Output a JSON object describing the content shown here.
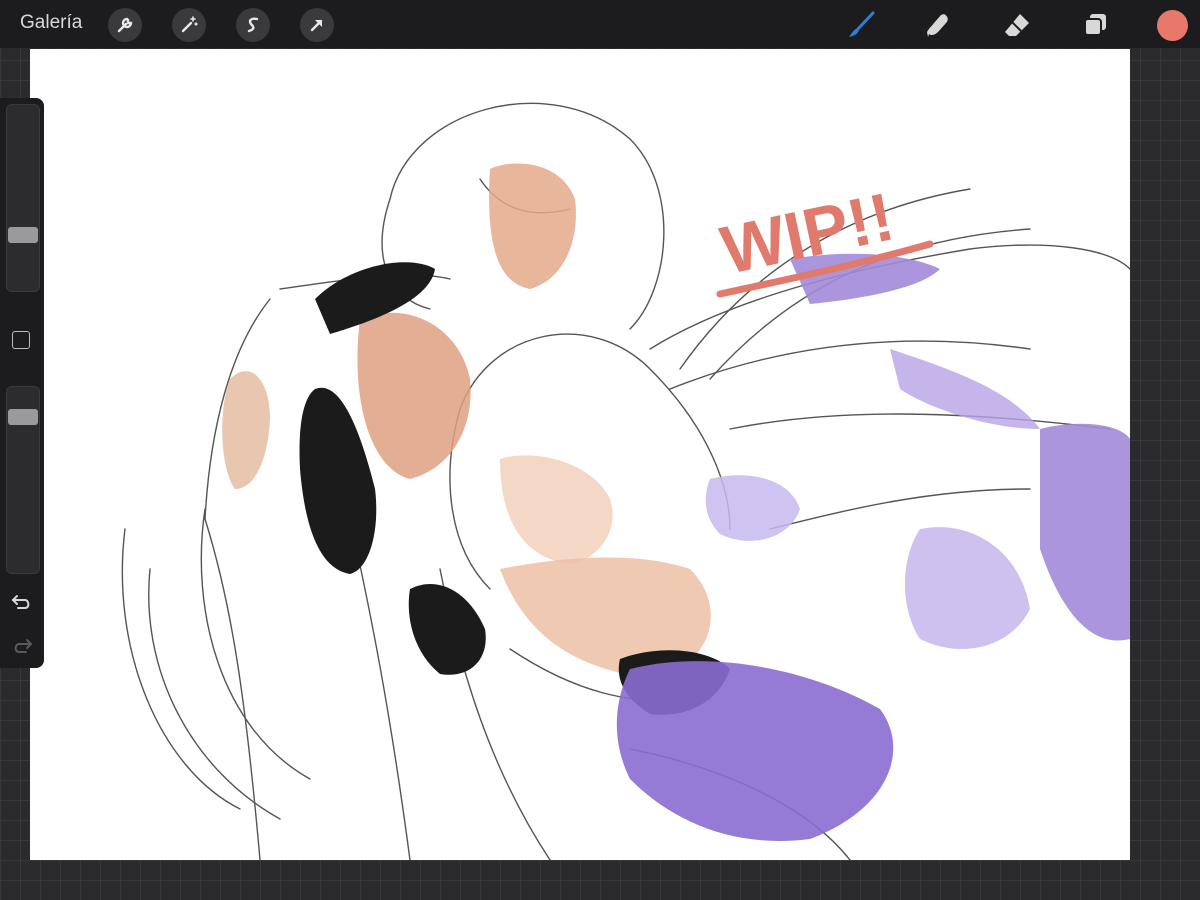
{
  "toolbar": {
    "gallery_label": "Galería",
    "left_tools": [
      {
        "name": "wrench-icon"
      },
      {
        "name": "magic-wand-icon"
      },
      {
        "name": "selection-s-icon"
      },
      {
        "name": "transform-arrow-icon"
      }
    ],
    "right_tools": [
      {
        "name": "brush-icon",
        "active": true
      },
      {
        "name": "smudge-icon"
      },
      {
        "name": "eraser-icon"
      },
      {
        "name": "layers-icon"
      }
    ],
    "active_color": "#e8796a"
  },
  "colors": {
    "active_tool": "#2f7fd6",
    "toolbar_bg": "#1c1c1e",
    "workspace_bg": "#2b2b2d",
    "wip_text": "#e07a6c",
    "lavender": "#a28bd9",
    "skin": "#e4a98a"
  },
  "canvas": {
    "annotation_text": "WIP!!"
  },
  "sidebar": {
    "brush_size_level": 0.72,
    "opacity_level": 0.13
  }
}
